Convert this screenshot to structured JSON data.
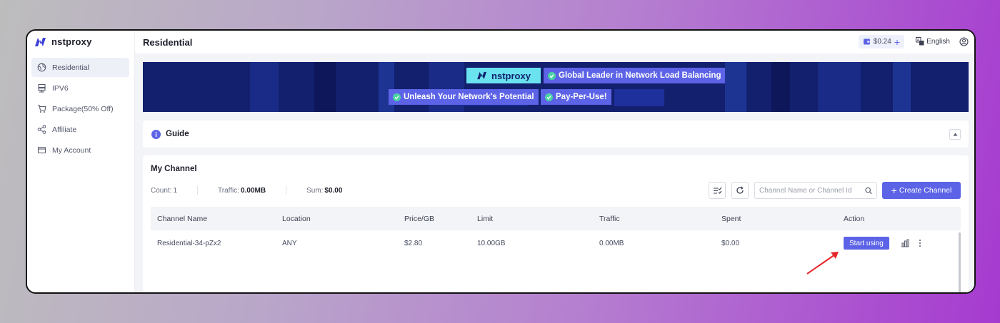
{
  "app": {
    "logo_text": "nstproxy"
  },
  "sidebar": {
    "items": [
      {
        "label": "Residential",
        "icon": "globe-icon",
        "active": true
      },
      {
        "label": "IPV6",
        "icon": "server-icon"
      },
      {
        "label": "Package(50% Off)",
        "icon": "cart-icon"
      },
      {
        "label": "Affiliate",
        "icon": "share-icon"
      },
      {
        "label": "My Account",
        "icon": "card-icon"
      }
    ]
  },
  "header": {
    "title": "Residential",
    "balance": "$0.24",
    "language": "English"
  },
  "banner": {
    "logo_text": "nstproxy",
    "tags": [
      "Global Leader in Network Load Balancing",
      "Unleash Your Network's Potential",
      "Pay-Per-Use!"
    ]
  },
  "guide": {
    "title": "Guide"
  },
  "channel": {
    "title": "My Channel",
    "stats": {
      "count_label": "Count:",
      "count_value": "1",
      "traffic_label": "Traffic:",
      "traffic_value": "0.00MB",
      "sum_label": "Sum:",
      "sum_value": "$0.00"
    },
    "search_placeholder": "Channel Name or Channel Id",
    "create_label": "Create Channel",
    "columns": [
      "Channel Name",
      "Location",
      "Price/GB",
      "Limit",
      "Traffic",
      "Spent",
      "Action"
    ],
    "rows": [
      {
        "name": "Residential-34-pZx2",
        "location": "ANY",
        "price": "$2.80",
        "limit": "10.00GB",
        "traffic": "0.00MB",
        "spent": "$0.00",
        "action_label": "Start using"
      }
    ]
  },
  "colors": {
    "accent": "#5c63e6",
    "banner_bg": "#13206e",
    "banner_logo_bg": "#6ae2ef",
    "annotation_arrow": "#e5252a"
  }
}
